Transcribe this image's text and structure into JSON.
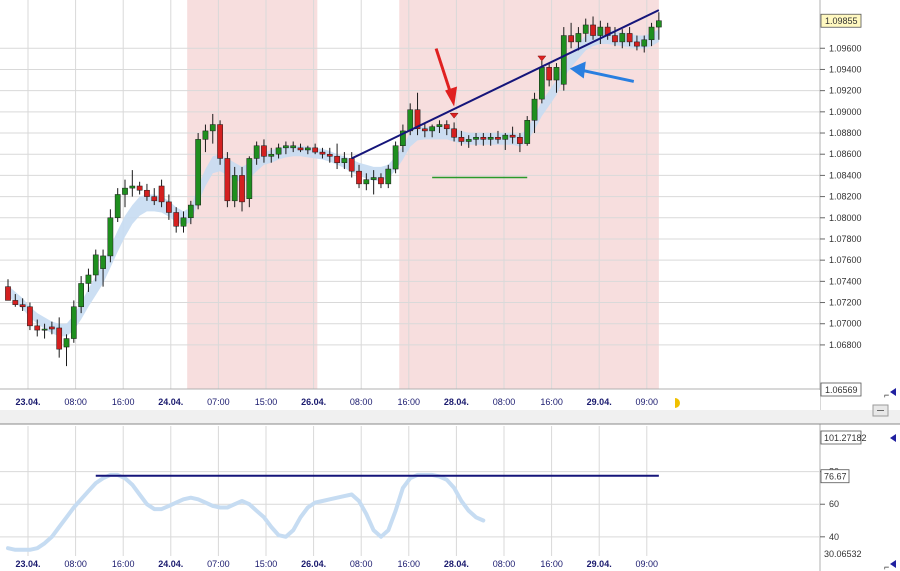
{
  "colors": {
    "background": "#ffffff",
    "grid": "#d9d9d9",
    "session_shade": "#f7dede",
    "up_candle": "#1f8f1f",
    "down_candle": "#d42020",
    "band": "#c6dcf2",
    "trendline": "#15157a",
    "red_arrow": "#e02020",
    "blue_arrow": "#2a7fe0",
    "signal_line": "#2a9a2a",
    "oscillator_line": "#c6dcf2",
    "level_line": "#15157a"
  },
  "icons": {
    "marker": "red-down-triangle-icon",
    "scroll": "scroll-marker-icon"
  },
  "chart_data": [
    {
      "type": "candlestick",
      "title": "",
      "y_range": [
        1.0645,
        1.0998
      ],
      "price_ticks": [
        "1.09600",
        "1.09400",
        "1.09200",
        "1.09000",
        "1.08800",
        "1.08600",
        "1.08400",
        "1.08200",
        "1.08000",
        "1.07800",
        "1.07600",
        "1.07400",
        "1.07200",
        "1.07000",
        "1.06800"
      ],
      "current_price_label": "1.09855",
      "low_price_label": "1.06569",
      "x_labels": [
        {
          "label": "23.04.",
          "bold": true
        },
        {
          "label": "08:00",
          "bold": false
        },
        {
          "label": "16:00",
          "bold": false
        },
        {
          "label": "24.04.",
          "bold": true
        },
        {
          "label": "07:00",
          "bold": false
        },
        {
          "label": "15:00",
          "bold": false
        },
        {
          "label": "26.04.",
          "bold": true
        },
        {
          "label": "08:00",
          "bold": false
        },
        {
          "label": "16:00",
          "bold": false
        },
        {
          "label": "28.04.",
          "bold": true
        },
        {
          "label": "08:00",
          "bold": false
        },
        {
          "label": "16:00",
          "bold": false
        },
        {
          "label": "29.04.",
          "bold": true
        },
        {
          "label": "09:00",
          "bold": false
        }
      ],
      "candles": [
        [
          1.0735,
          1.0742,
          1.0728,
          1.0722
        ],
        [
          1.0722,
          1.0728,
          1.0716,
          1.0718
        ],
        [
          1.0718,
          1.0724,
          1.0712,
          1.0716
        ],
        [
          1.0716,
          1.072,
          1.0694,
          1.0698
        ],
        [
          1.0698,
          1.0704,
          1.0688,
          1.0694
        ],
        [
          1.0694,
          1.07,
          1.0686,
          1.0695
        ],
        [
          1.0697,
          1.0702,
          1.069,
          1.0695
        ],
        [
          1.0696,
          1.0706,
          1.0668,
          1.0676
        ],
        [
          1.0678,
          1.069,
          1.066,
          1.0686
        ],
        [
          1.0686,
          1.0722,
          1.0682,
          1.0716
        ],
        [
          1.0716,
          1.0745,
          1.071,
          1.0738
        ],
        [
          1.0738,
          1.0752,
          1.073,
          1.0746
        ],
        [
          1.0746,
          1.077,
          1.074,
          1.0765
        ],
        [
          1.0752,
          1.077,
          1.0735,
          1.0764
        ],
        [
          1.0764,
          1.0808,
          1.0758,
          1.08
        ],
        [
          1.08,
          1.0828,
          1.0796,
          1.0822
        ],
        [
          1.0822,
          1.0836,
          1.081,
          1.0828
        ],
        [
          1.0828,
          1.0845,
          1.082,
          1.083
        ],
        [
          1.083,
          1.0834,
          1.0822,
          1.0826
        ],
        [
          1.0826,
          1.0832,
          1.0816,
          1.082
        ],
        [
          1.082,
          1.0828,
          1.0812,
          1.0816
        ],
        [
          1.083,
          1.0836,
          1.081,
          1.0815
        ],
        [
          1.0815,
          1.0822,
          1.0798,
          1.0805
        ],
        [
          1.0805,
          1.081,
          1.0786,
          1.0792
        ],
        [
          1.0792,
          1.0806,
          1.0786,
          1.08
        ],
        [
          1.08,
          1.0816,
          1.0794,
          1.0812
        ],
        [
          1.0812,
          1.088,
          1.0808,
          1.0874
        ],
        [
          1.0874,
          1.0888,
          1.0862,
          1.0882
        ],
        [
          1.0882,
          1.0898,
          1.087,
          1.0888
        ],
        [
          1.0888,
          1.0892,
          1.085,
          1.0856
        ],
        [
          1.0856,
          1.0862,
          1.081,
          1.0816
        ],
        [
          1.0816,
          1.0848,
          1.081,
          1.084
        ],
        [
          1.084,
          1.0848,
          1.0806,
          1.0815
        ],
        [
          1.0818,
          1.0858,
          1.081,
          1.0856
        ],
        [
          1.0856,
          1.0872,
          1.085,
          1.0868
        ],
        [
          1.0868,
          1.0874,
          1.0852,
          1.0858
        ],
        [
          1.0858,
          1.0866,
          1.0852,
          1.086
        ],
        [
          1.086,
          1.087,
          1.0856,
          1.0866
        ],
        [
          1.0866,
          1.0872,
          1.086,
          1.0868
        ],
        [
          1.0866,
          1.0872,
          1.0862,
          1.0868
        ],
        [
          1.0866,
          1.087,
          1.0862,
          1.0864
        ],
        [
          1.0864,
          1.0868,
          1.086,
          1.0866
        ],
        [
          1.0866,
          1.087,
          1.086,
          1.0862
        ],
        [
          1.0862,
          1.0866,
          1.0856,
          1.086
        ],
        [
          1.086,
          1.0866,
          1.0852,
          1.0858
        ],
        [
          1.0858,
          1.087,
          1.0846,
          1.0852
        ],
        [
          1.0852,
          1.0862,
          1.0846,
          1.0856
        ],
        [
          1.0856,
          1.0862,
          1.0838,
          1.0844
        ],
        [
          1.0844,
          1.085,
          1.0828,
          1.0832
        ],
        [
          1.0832,
          1.0842,
          1.0826,
          1.0836
        ],
        [
          1.0836,
          1.0845,
          1.0822,
          1.0838
        ],
        [
          1.0838,
          1.0842,
          1.0828,
          1.0832
        ],
        [
          1.0832,
          1.085,
          1.0828,
          1.0846
        ],
        [
          1.0846,
          1.0872,
          1.0842,
          1.0868
        ],
        [
          1.0868,
          1.0888,
          1.0862,
          1.0882
        ],
        [
          1.0882,
          1.0908,
          1.0878,
          1.0902
        ],
        [
          1.0902,
          1.0918,
          1.0878,
          1.0884
        ],
        [
          1.0884,
          1.089,
          1.0876,
          1.0882
        ],
        [
          1.0882,
          1.0888,
          1.0876,
          1.0886
        ],
        [
          1.0886,
          1.0892,
          1.088,
          1.0888
        ],
        [
          1.0888,
          1.0892,
          1.0878,
          1.0884
        ],
        [
          1.0884,
          1.089,
          1.0872,
          1.0876
        ],
        [
          1.0876,
          1.0882,
          1.0868,
          1.0872
        ],
        [
          1.0872,
          1.0878,
          1.0866,
          1.0874
        ],
        [
          1.0874,
          1.088,
          1.0868,
          1.0876
        ],
        [
          1.0876,
          1.088,
          1.0868,
          1.0874
        ],
        [
          1.0874,
          1.088,
          1.0868,
          1.0876
        ],
        [
          1.0876,
          1.0882,
          1.087,
          1.0874
        ],
        [
          1.0874,
          1.088,
          1.0864,
          1.0878
        ],
        [
          1.0878,
          1.0886,
          1.087,
          1.0876
        ],
        [
          1.0876,
          1.088,
          1.0862,
          1.087
        ],
        [
          1.087,
          1.0896,
          1.0868,
          1.0892
        ],
        [
          1.0892,
          1.0918,
          1.088,
          1.0912
        ],
        [
          1.0912,
          1.0948,
          1.0908,
          1.0942
        ],
        [
          1.0942,
          1.0946,
          1.0924,
          1.093
        ],
        [
          1.093,
          1.0946,
          1.0918,
          1.0942
        ],
        [
          1.0926,
          1.098,
          1.092,
          1.0972
        ],
        [
          1.0972,
          1.0984,
          1.096,
          1.0966
        ],
        [
          1.0966,
          1.098,
          1.0958,
          1.0974
        ],
        [
          1.0974,
          1.0988,
          1.0966,
          1.0982
        ],
        [
          1.0982,
          1.099,
          1.0968,
          1.0972
        ],
        [
          1.0972,
          1.0986,
          1.0964,
          1.098
        ],
        [
          1.098,
          1.0984,
          1.0968,
          1.0972
        ],
        [
          1.0972,
          1.098,
          1.0962,
          1.0966
        ],
        [
          1.0966,
          1.0978,
          1.096,
          1.0974
        ],
        [
          1.0974,
          1.098,
          1.0962,
          1.0966
        ],
        [
          1.0966,
          1.0972,
          1.0958,
          1.0962
        ],
        [
          1.0962,
          1.0972,
          1.0956,
          1.0968
        ],
        [
          1.0968,
          1.0984,
          1.0962,
          1.098
        ],
        [
          1.098,
          1.0994,
          1.0968,
          1.0986
        ]
      ],
      "band_upper": [
        1.0736,
        1.073,
        1.0724,
        1.0716,
        1.071,
        1.0706,
        1.0702,
        1.07,
        1.07,
        1.0708,
        1.072,
        1.0733,
        1.0745,
        1.0757,
        1.0773,
        1.0788,
        1.0802,
        1.0812,
        1.082,
        1.0822,
        1.0822,
        1.082,
        1.0816,
        1.081,
        1.0806,
        1.081,
        1.083,
        1.0846,
        1.0858,
        1.086,
        1.0856,
        1.0852,
        1.0848,
        1.0852,
        1.0858,
        1.0862,
        1.0864,
        1.0866,
        1.0868,
        1.0868,
        1.0868,
        1.0867,
        1.0866,
        1.0865,
        1.0863,
        1.086,
        1.0858,
        1.0855,
        1.0852,
        1.085,
        1.0848,
        1.0848,
        1.085,
        1.0858,
        1.0868,
        1.088,
        1.0886,
        1.0886,
        1.0886,
        1.0886,
        1.0886,
        1.0884,
        1.0882,
        1.088,
        1.088,
        1.088,
        1.088,
        1.088,
        1.088,
        1.088,
        1.0878,
        1.0884,
        1.0896,
        1.091,
        1.092,
        1.093,
        1.0946,
        1.0956,
        1.0964,
        1.0972,
        1.0976,
        1.0978,
        1.0978,
        1.0976,
        1.0975,
        1.0974,
        1.0972,
        1.0972,
        1.0974,
        1.0978
      ],
      "band_lower": [
        1.0726,
        1.072,
        1.0714,
        1.0706,
        1.07,
        1.0695,
        1.0691,
        1.0688,
        1.0688,
        1.0694,
        1.0704,
        1.0716,
        1.0727,
        1.0738,
        1.0753,
        1.0768,
        1.0782,
        1.0794,
        1.0802,
        1.0806,
        1.0806,
        1.0805,
        1.0801,
        1.0796,
        1.0793,
        1.0796,
        1.0814,
        1.083,
        1.0842,
        1.0844,
        1.084,
        1.0836,
        1.0833,
        1.0837,
        1.0844,
        1.085,
        1.0852,
        1.0855,
        1.0857,
        1.0858,
        1.0858,
        1.0857,
        1.0856,
        1.0855,
        1.0853,
        1.085,
        1.0847,
        1.0843,
        1.084,
        1.0837,
        1.0835,
        1.0835,
        1.0837,
        1.0845,
        1.0855,
        1.0867,
        1.0873,
        1.0874,
        1.0874,
        1.0874,
        1.0874,
        1.0872,
        1.087,
        1.0869,
        1.0869,
        1.0869,
        1.0869,
        1.0869,
        1.0869,
        1.0869,
        1.0867,
        1.0872,
        1.0883,
        1.0896,
        1.0906,
        1.0916,
        1.0932,
        1.0942,
        1.095,
        1.0958,
        1.0962,
        1.0964,
        1.0964,
        1.0963,
        1.0962,
        1.0961,
        1.096,
        1.096,
        1.0962,
        1.0966
      ],
      "trendline": [
        [
          1.0856,
          47
        ],
        [
          1.0996,
          89
        ]
      ],
      "signal_segment": [
        [
          1.0838,
          58
        ],
        [
          1.0838,
          71
        ]
      ],
      "session_shading": [
        [
          24.5,
          42.3
        ],
        [
          53.5,
          89
        ]
      ]
    },
    {
      "type": "line",
      "y_range": [
        30.06532,
        101.27182
      ],
      "ticks": [
        "80",
        "60",
        "40"
      ],
      "top_label": "101.27182",
      "current_label": "76.67",
      "bottom_label": "30.06532",
      "level": 77.5,
      "series": [
        {
          "values": [
            33,
            32,
            32,
            32,
            33,
            36,
            40,
            46,
            52,
            58,
            63,
            68,
            73,
            76,
            78,
            78,
            76,
            72,
            66,
            60,
            57,
            57,
            59,
            61,
            63,
            64,
            63,
            61,
            59,
            58,
            58,
            60,
            62,
            60,
            56,
            52,
            46,
            41,
            40,
            44,
            52,
            58,
            61,
            62,
            63,
            64,
            65,
            66,
            62,
            54,
            44,
            40,
            44,
            56,
            70,
            76,
            78,
            78,
            78,
            77,
            75,
            70,
            62,
            56,
            52,
            50
          ]
        }
      ]
    }
  ]
}
